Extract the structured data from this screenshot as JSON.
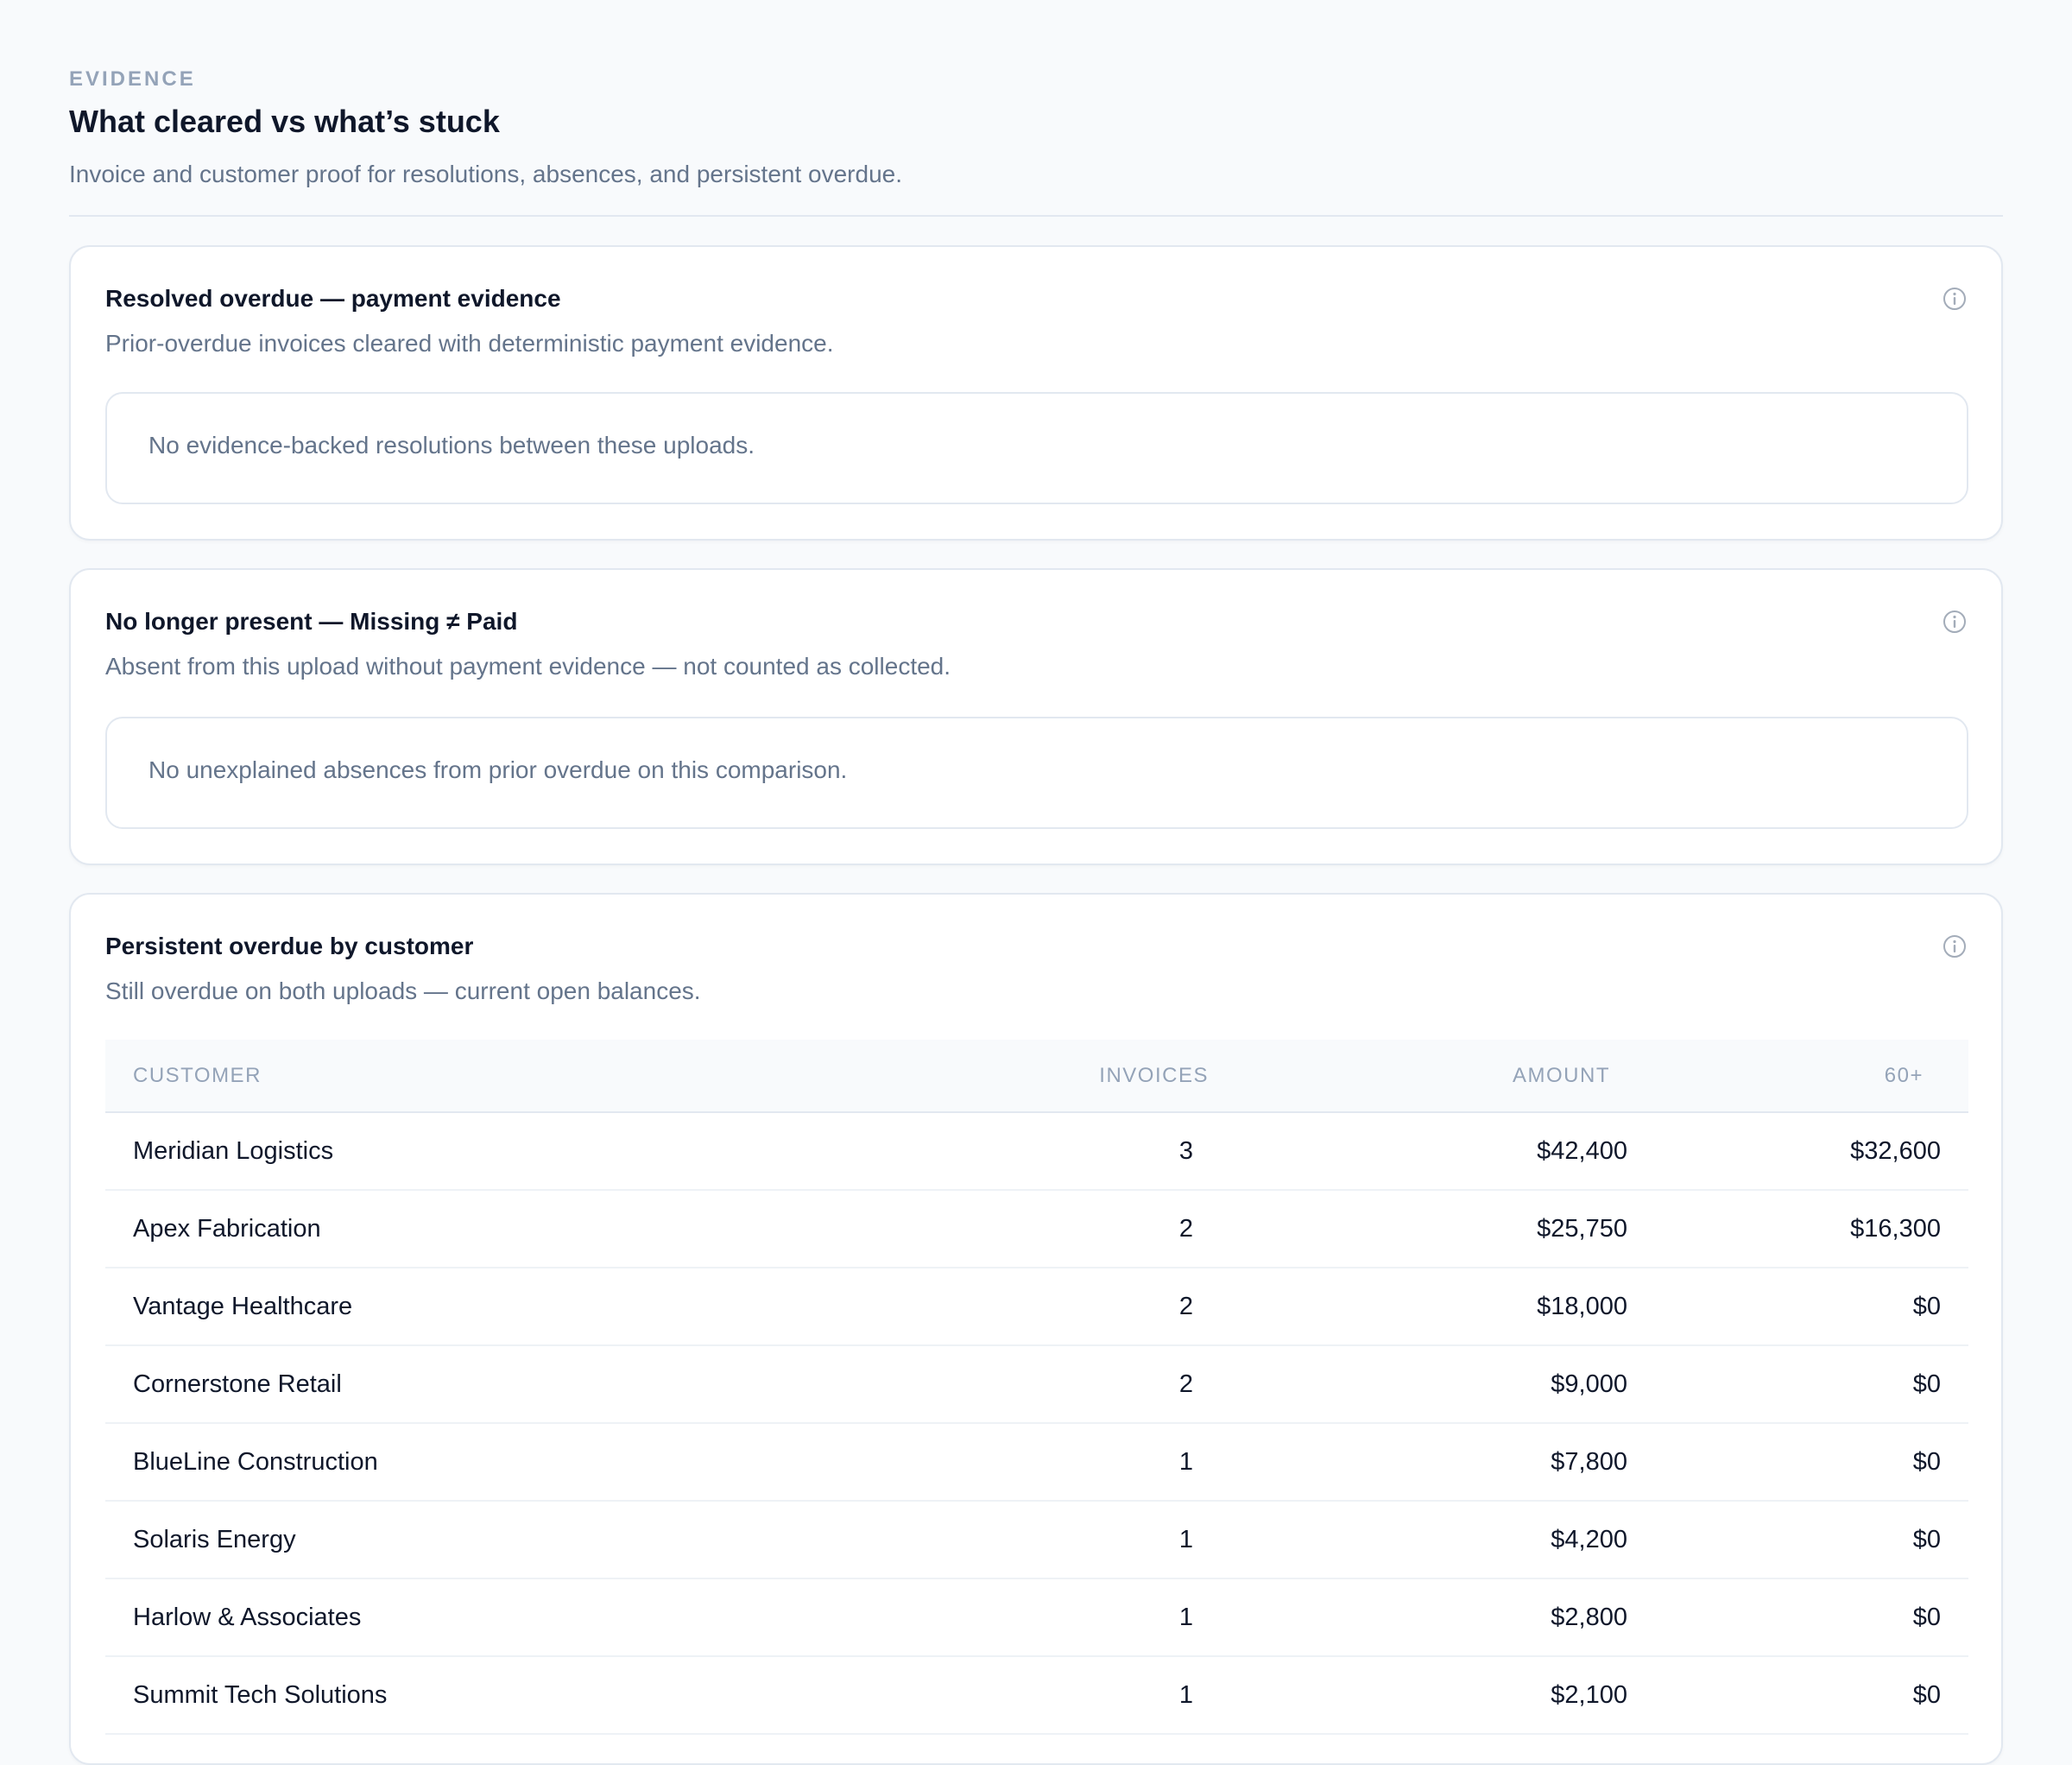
{
  "header": {
    "eyebrow": "EVIDENCE",
    "title": "What cleared vs what’s stuck",
    "subtitle": "Invoice and customer proof for resolutions, absences, and persistent overdue."
  },
  "resolved": {
    "title": "Resolved overdue — payment evidence",
    "description": "Prior-overdue invoices cleared with deterministic payment evidence.",
    "empty_message": "No evidence-backed resolutions between these uploads.",
    "icon": "info-icon"
  },
  "absent": {
    "title": "No longer present — Missing ≠ Paid",
    "description": "Absent from this upload without payment evidence — not counted as collected.",
    "empty_message": "No unexplained absences from prior overdue on this comparison.",
    "icon": "info-icon"
  },
  "persistent": {
    "title": "Persistent overdue by customer",
    "description": "Still overdue on both uploads — current open balances.",
    "icon": "info-icon",
    "columns": [
      "CUSTOMER",
      "INVOICES",
      "AMOUNT",
      "60+"
    ],
    "rows": [
      [
        "Meridian Logistics",
        "3",
        "$42,400",
        "$32,600"
      ],
      [
        "Apex Fabrication",
        "2",
        "$25,750",
        "$16,300"
      ],
      [
        "Vantage Healthcare",
        "2",
        "$18,000",
        "$0"
      ],
      [
        "Cornerstone Retail",
        "2",
        "$9,000",
        "$0"
      ],
      [
        "BlueLine Construction",
        "1",
        "$7,800",
        "$0"
      ],
      [
        "Solaris Energy",
        "1",
        "$4,200",
        "$0"
      ],
      [
        "Harlow & Associates",
        "1",
        "$2,800",
        "$0"
      ],
      [
        "Summit Tech Solutions",
        "1",
        "$2,100",
        "$0"
      ]
    ]
  },
  "colors": {
    "background": "#f8fafc",
    "card": "#ffffff",
    "border": "#e2e8f0",
    "text_primary": "#0f172a",
    "text_muted": "#64748b",
    "text_faint": "#94a3b8"
  }
}
